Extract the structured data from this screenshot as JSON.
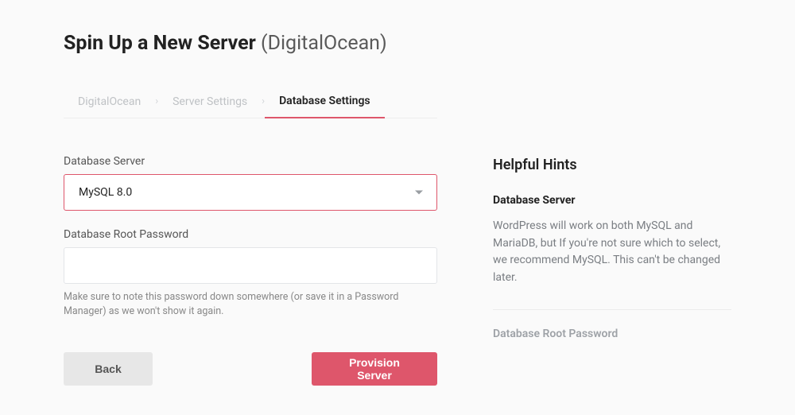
{
  "header": {
    "title_main": "Spin Up a New Server",
    "title_provider": "(DigitalOcean)"
  },
  "tabs": {
    "step1": "DigitalOcean",
    "step2": "Server Settings",
    "step3": "Database Settings"
  },
  "form": {
    "db_server_label": "Database Server",
    "db_server_value": "MySQL 8.0",
    "root_pw_label": "Database Root Password",
    "root_pw_value": "",
    "root_pw_helper": "Make sure to note this password down somewhere (or save it in a Password Manager) as we won't show it again."
  },
  "actions": {
    "back": "Back",
    "submit": "Provision Server"
  },
  "hints": {
    "title": "Helpful Hints",
    "db_server_heading": "Database Server",
    "db_server_body": "WordPress will work on both MySQL and MariaDB, but If you're not sure which to select, we recommend MySQL. This can't be changed later.",
    "root_pw_heading": "Database Root Password"
  }
}
